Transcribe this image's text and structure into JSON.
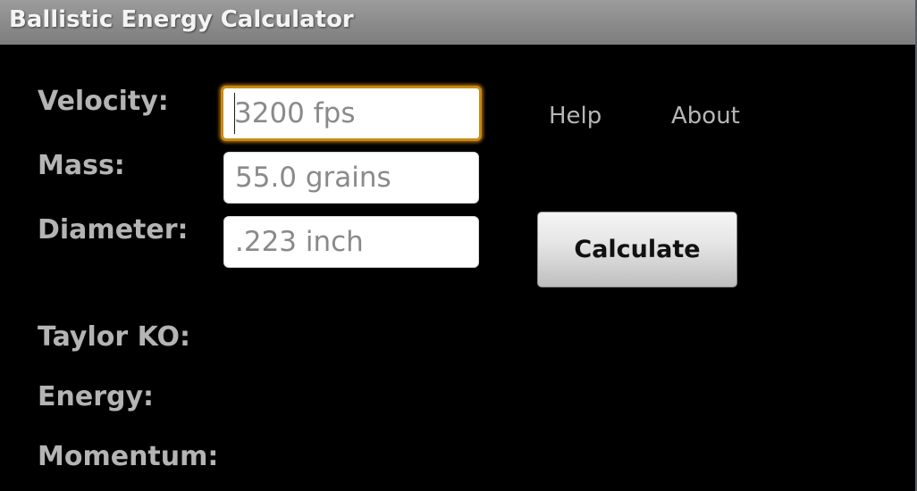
{
  "window": {
    "title": "Ballistic Energy Calculator"
  },
  "inputs": {
    "velocity": {
      "label": "Velocity:",
      "placeholder": "3200 fps",
      "value": "",
      "focused": true
    },
    "mass": {
      "label": "Mass:",
      "placeholder": "55.0 grains",
      "value": ""
    },
    "diameter": {
      "label": "Diameter:",
      "placeholder": ".223 inch",
      "value": ""
    }
  },
  "links": {
    "help": "Help",
    "about": "About"
  },
  "actions": {
    "calculate_label": "Calculate"
  },
  "results": {
    "taylor_ko_label": "Taylor KO:",
    "taylor_ko_value": "",
    "energy_label": "Energy:",
    "energy_value": "",
    "momentum_label": "Momentum:",
    "momentum_value": ""
  },
  "colors": {
    "focus_accent": "#c98a14",
    "label_text": "#b4b4b4",
    "background": "#000000"
  }
}
